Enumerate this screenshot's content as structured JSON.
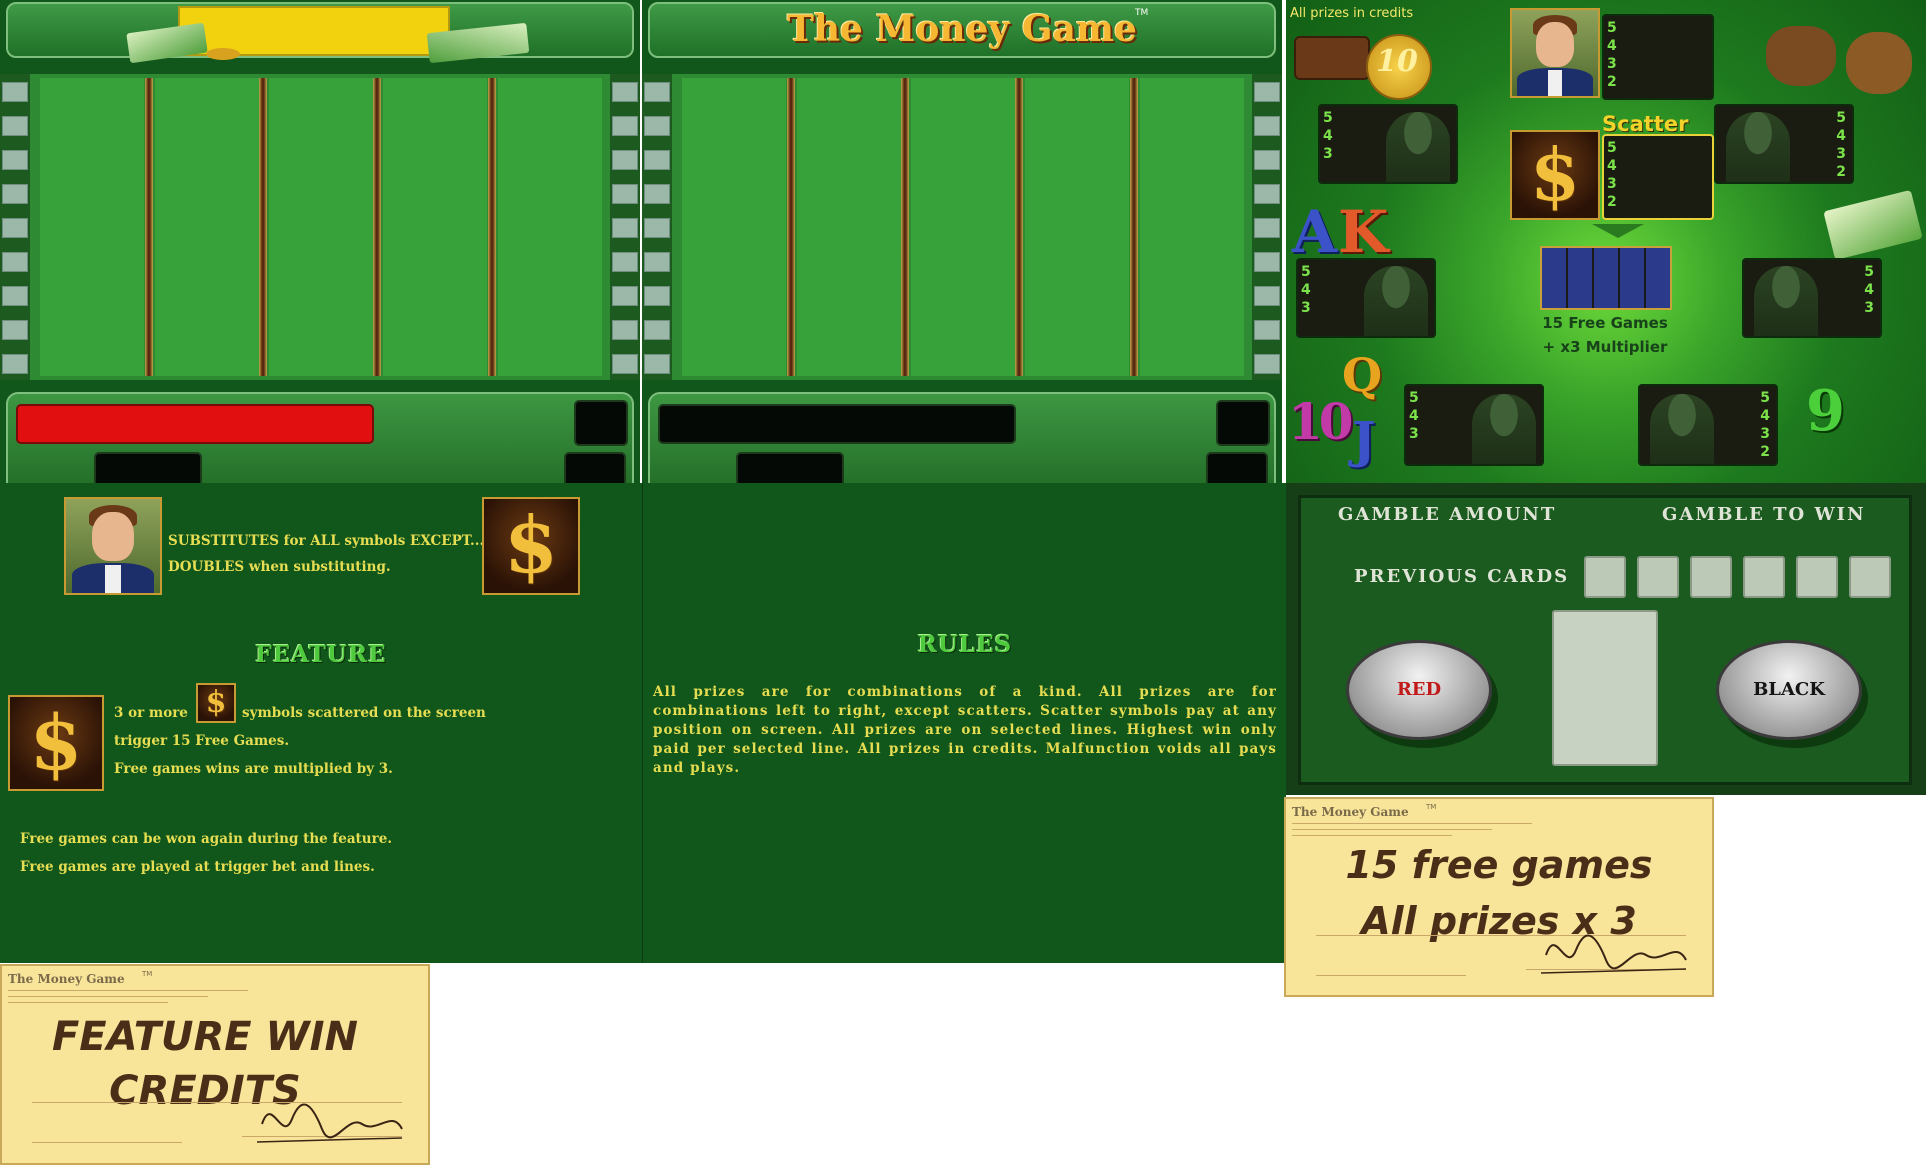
{
  "paytable": {
    "title": "The Money Game",
    "title_tm": "TM",
    "prizes_note": "All prizes in credits",
    "man_box": [
      "5",
      "4",
      "3",
      "2"
    ],
    "scatter_label": "Scatter",
    "scatter_box": [
      "5",
      "4",
      "3",
      "2"
    ],
    "left_top_box": [
      "5",
      "4",
      "3"
    ],
    "right_top_box": [
      "5",
      "4",
      "3",
      "2"
    ],
    "left_mid_box": [
      "5",
      "4",
      "3"
    ],
    "right_mid_box": [
      "5",
      "4",
      "3"
    ],
    "left_bottom_box": [
      "5",
      "4",
      "3"
    ],
    "right_bottom_box": [
      "5",
      "4",
      "3",
      "2"
    ],
    "coin_value": "10",
    "letters": {
      "a": "A",
      "k": "K",
      "q": "Q",
      "ten": "10",
      "j": "J",
      "nine": "9"
    },
    "free_games_line1": "15 Free Games",
    "free_games_line2": "+ x3 Multiplier"
  },
  "info": {
    "substitutes_line1": "SUBSTITUTES for ALL symbols EXCEPT...",
    "substitutes_line2": "DOUBLES when substituting.",
    "feature_heading": "FEATURE",
    "feature_text_a": "3 or more",
    "feature_text_b": "symbols scattered on the screen",
    "feature_text_c": "trigger 15 Free Games.",
    "feature_text_d": "Free games wins are multiplied by 3.",
    "feature_text_e": "Free games can be won again during the feature.",
    "feature_text_f": "Free games are played at trigger bet and lines.",
    "rules_heading": "RULES",
    "rules_text": "All prizes are for combinations of a kind. All prizes are for combinations left to right, except scatters. Scatter symbols pay at any position on screen. All prizes are on selected lines. Highest win only paid per selected line. All prizes in credits. Malfunction voids all pays and plays."
  },
  "gamble": {
    "amount_label": "GAMBLE AMOUNT",
    "to_win_label": "GAMBLE TO WIN",
    "previous_cards_label": "PREVIOUS CARDS",
    "red_label": "RED",
    "black_label": "BLACK"
  },
  "notes": {
    "brand": "The Money Game",
    "brand_tm": "TM",
    "free_games_line1": "15 free games",
    "free_games_line2": "All prizes x 3",
    "feature_win_line1": "FEATURE WIN",
    "feature_win_line2": "CREDITS"
  },
  "colors": {
    "green": "#11571b",
    "yellow_text": "#e7dd52",
    "red_bar": "#e10f0f",
    "note": "#f8e59a"
  }
}
